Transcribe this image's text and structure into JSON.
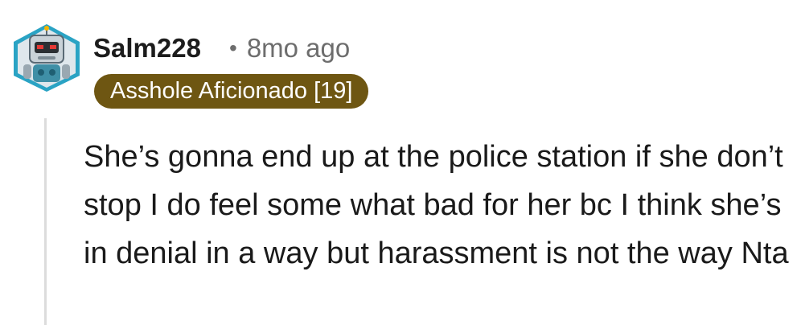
{
  "comment": {
    "author": "Salm228",
    "separator": "•",
    "timestamp": "8mo ago",
    "flair": "Asshole Aficionado [19]",
    "body": "She’s gonna end up at the police station if she don’t stop I do feel some what bad for her bc I think she’s in denial in a way but harassment is not the way Nta"
  },
  "colors": {
    "flair_bg": "#6e5612",
    "flair_text": "#ffffff",
    "author_text": "#1c1c1c",
    "meta_text": "#6d6d6d",
    "thread_line": "#dcdcdc",
    "avatar_frame": "#2aa3c4"
  },
  "icons": {
    "avatar": "robot-snoo-avatar-icon"
  }
}
